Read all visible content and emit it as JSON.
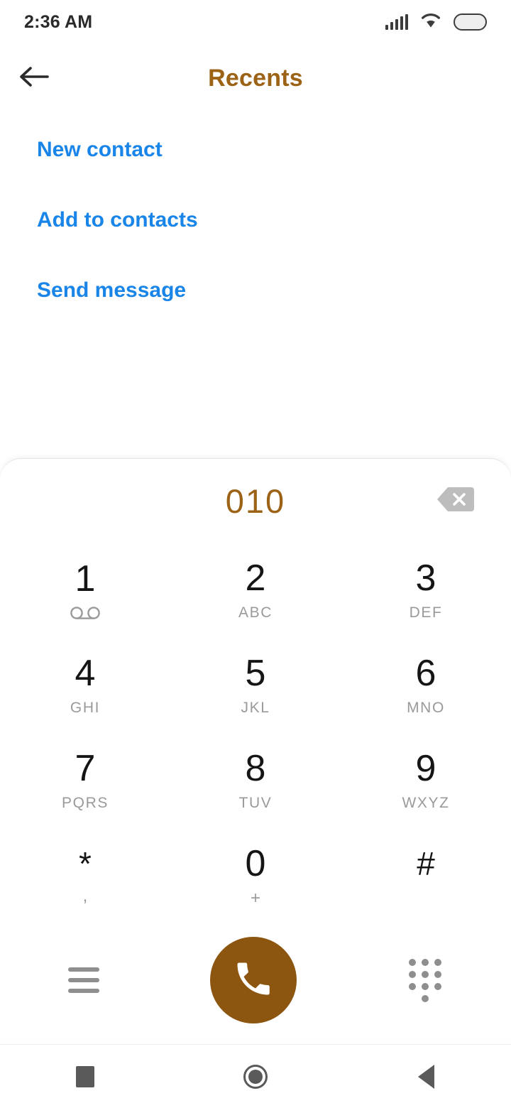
{
  "status_bar": {
    "time": "2:36 AM",
    "icons": [
      "signal-bars-icon",
      "wifi-icon",
      "battery-icon"
    ]
  },
  "header": {
    "back_icon": "arrow-left-icon",
    "title": "Recents"
  },
  "action_links": [
    {
      "label": "New contact"
    },
    {
      "label": "Add to contacts"
    },
    {
      "label": "Send message"
    }
  ],
  "dialer": {
    "dialed_number": "010",
    "backspace_icon": "backspace-icon",
    "keypad": [
      [
        {
          "digit": "1",
          "sub": "",
          "sub_icon": "voicemail-icon"
        },
        {
          "digit": "2",
          "sub": "ABC",
          "sub_icon": ""
        },
        {
          "digit": "3",
          "sub": "DEF",
          "sub_icon": ""
        }
      ],
      [
        {
          "digit": "4",
          "sub": "GHI",
          "sub_icon": ""
        },
        {
          "digit": "5",
          "sub": "JKL",
          "sub_icon": ""
        },
        {
          "digit": "6",
          "sub": "MNO",
          "sub_icon": ""
        }
      ],
      [
        {
          "digit": "7",
          "sub": "PQRS",
          "sub_icon": ""
        },
        {
          "digit": "8",
          "sub": "TUV",
          "sub_icon": ""
        },
        {
          "digit": "9",
          "sub": "WXYZ",
          "sub_icon": ""
        }
      ],
      [
        {
          "digit": "*",
          "sub": ",",
          "sub_icon": ""
        },
        {
          "digit": "0",
          "sub": "+",
          "sub_icon": ""
        },
        {
          "digit": "#",
          "sub": "",
          "sub_icon": ""
        }
      ]
    ],
    "actions": {
      "menu_icon": "hamburger-menu-icon",
      "call_icon": "phone-handset-icon",
      "dialpad_icon": "dialpad-grid-icon"
    }
  },
  "nav_bar": {
    "recents_icon": "square-recents-icon",
    "home_icon": "circle-home-icon",
    "back_icon": "triangle-back-icon"
  },
  "colors": {
    "accent_brown": "#9c6216",
    "call_button_brown": "#8d5610",
    "link_blue": "#1a85e8",
    "digit_black": "#151515",
    "sublabel_gray": "#9a9a9a",
    "icon_gray": "#8e8e8e",
    "nav_gray": "#5a5a5a"
  }
}
